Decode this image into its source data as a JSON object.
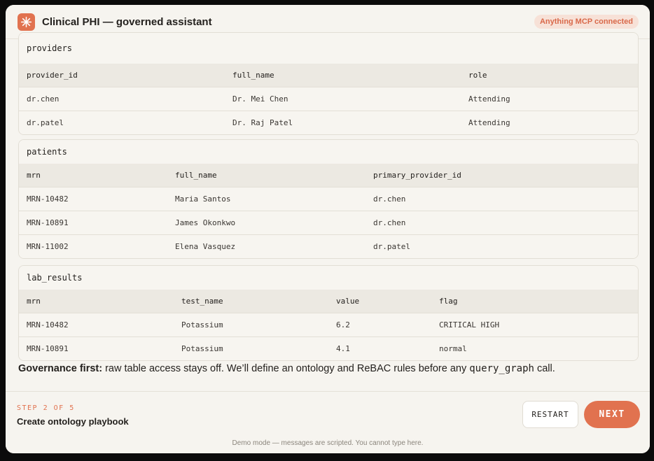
{
  "header": {
    "title": "Clinical PHI — governed assistant",
    "badge": "Anything MCP connected",
    "accent": "#e1724f"
  },
  "tables": {
    "providers": {
      "name": "providers",
      "columns": [
        "provider_id",
        "full_name",
        "role"
      ],
      "rows": [
        [
          "dr.chen",
          "Dr. Mei Chen",
          "Attending"
        ],
        [
          "dr.patel",
          "Dr. Raj Patel",
          "Attending"
        ]
      ]
    },
    "patients": {
      "name": "patients",
      "columns": [
        "mrn",
        "full_name",
        "primary_provider_id"
      ],
      "rows": [
        [
          "MRN-10482",
          "Maria Santos",
          "dr.chen"
        ],
        [
          "MRN-10891",
          "James Okonkwo",
          "dr.chen"
        ],
        [
          "MRN-11002",
          "Elena Vasquez",
          "dr.patel"
        ]
      ]
    },
    "lab_results": {
      "name": "lab_results",
      "columns": [
        "mrn",
        "test_name",
        "value",
        "flag"
      ],
      "rows": [
        [
          "MRN-10482",
          "Potassium",
          "6.2",
          "CRITICAL HIGH"
        ],
        [
          "MRN-10891",
          "Potassium",
          "4.1",
          "normal"
        ]
      ]
    }
  },
  "governance": {
    "lead": "Governance first:",
    "text1": " raw table access stays off. We’ll define an ontology and ReBAC rules before any ",
    "code": "query_graph",
    "text2": " call."
  },
  "footer": {
    "step_label": "STEP 2 OF 5",
    "step_title": "Create ontology playbook",
    "restart_label": "RESTART",
    "next_label": "NEXT",
    "demo_note": "Demo mode — messages are scripted. You cannot type here."
  }
}
